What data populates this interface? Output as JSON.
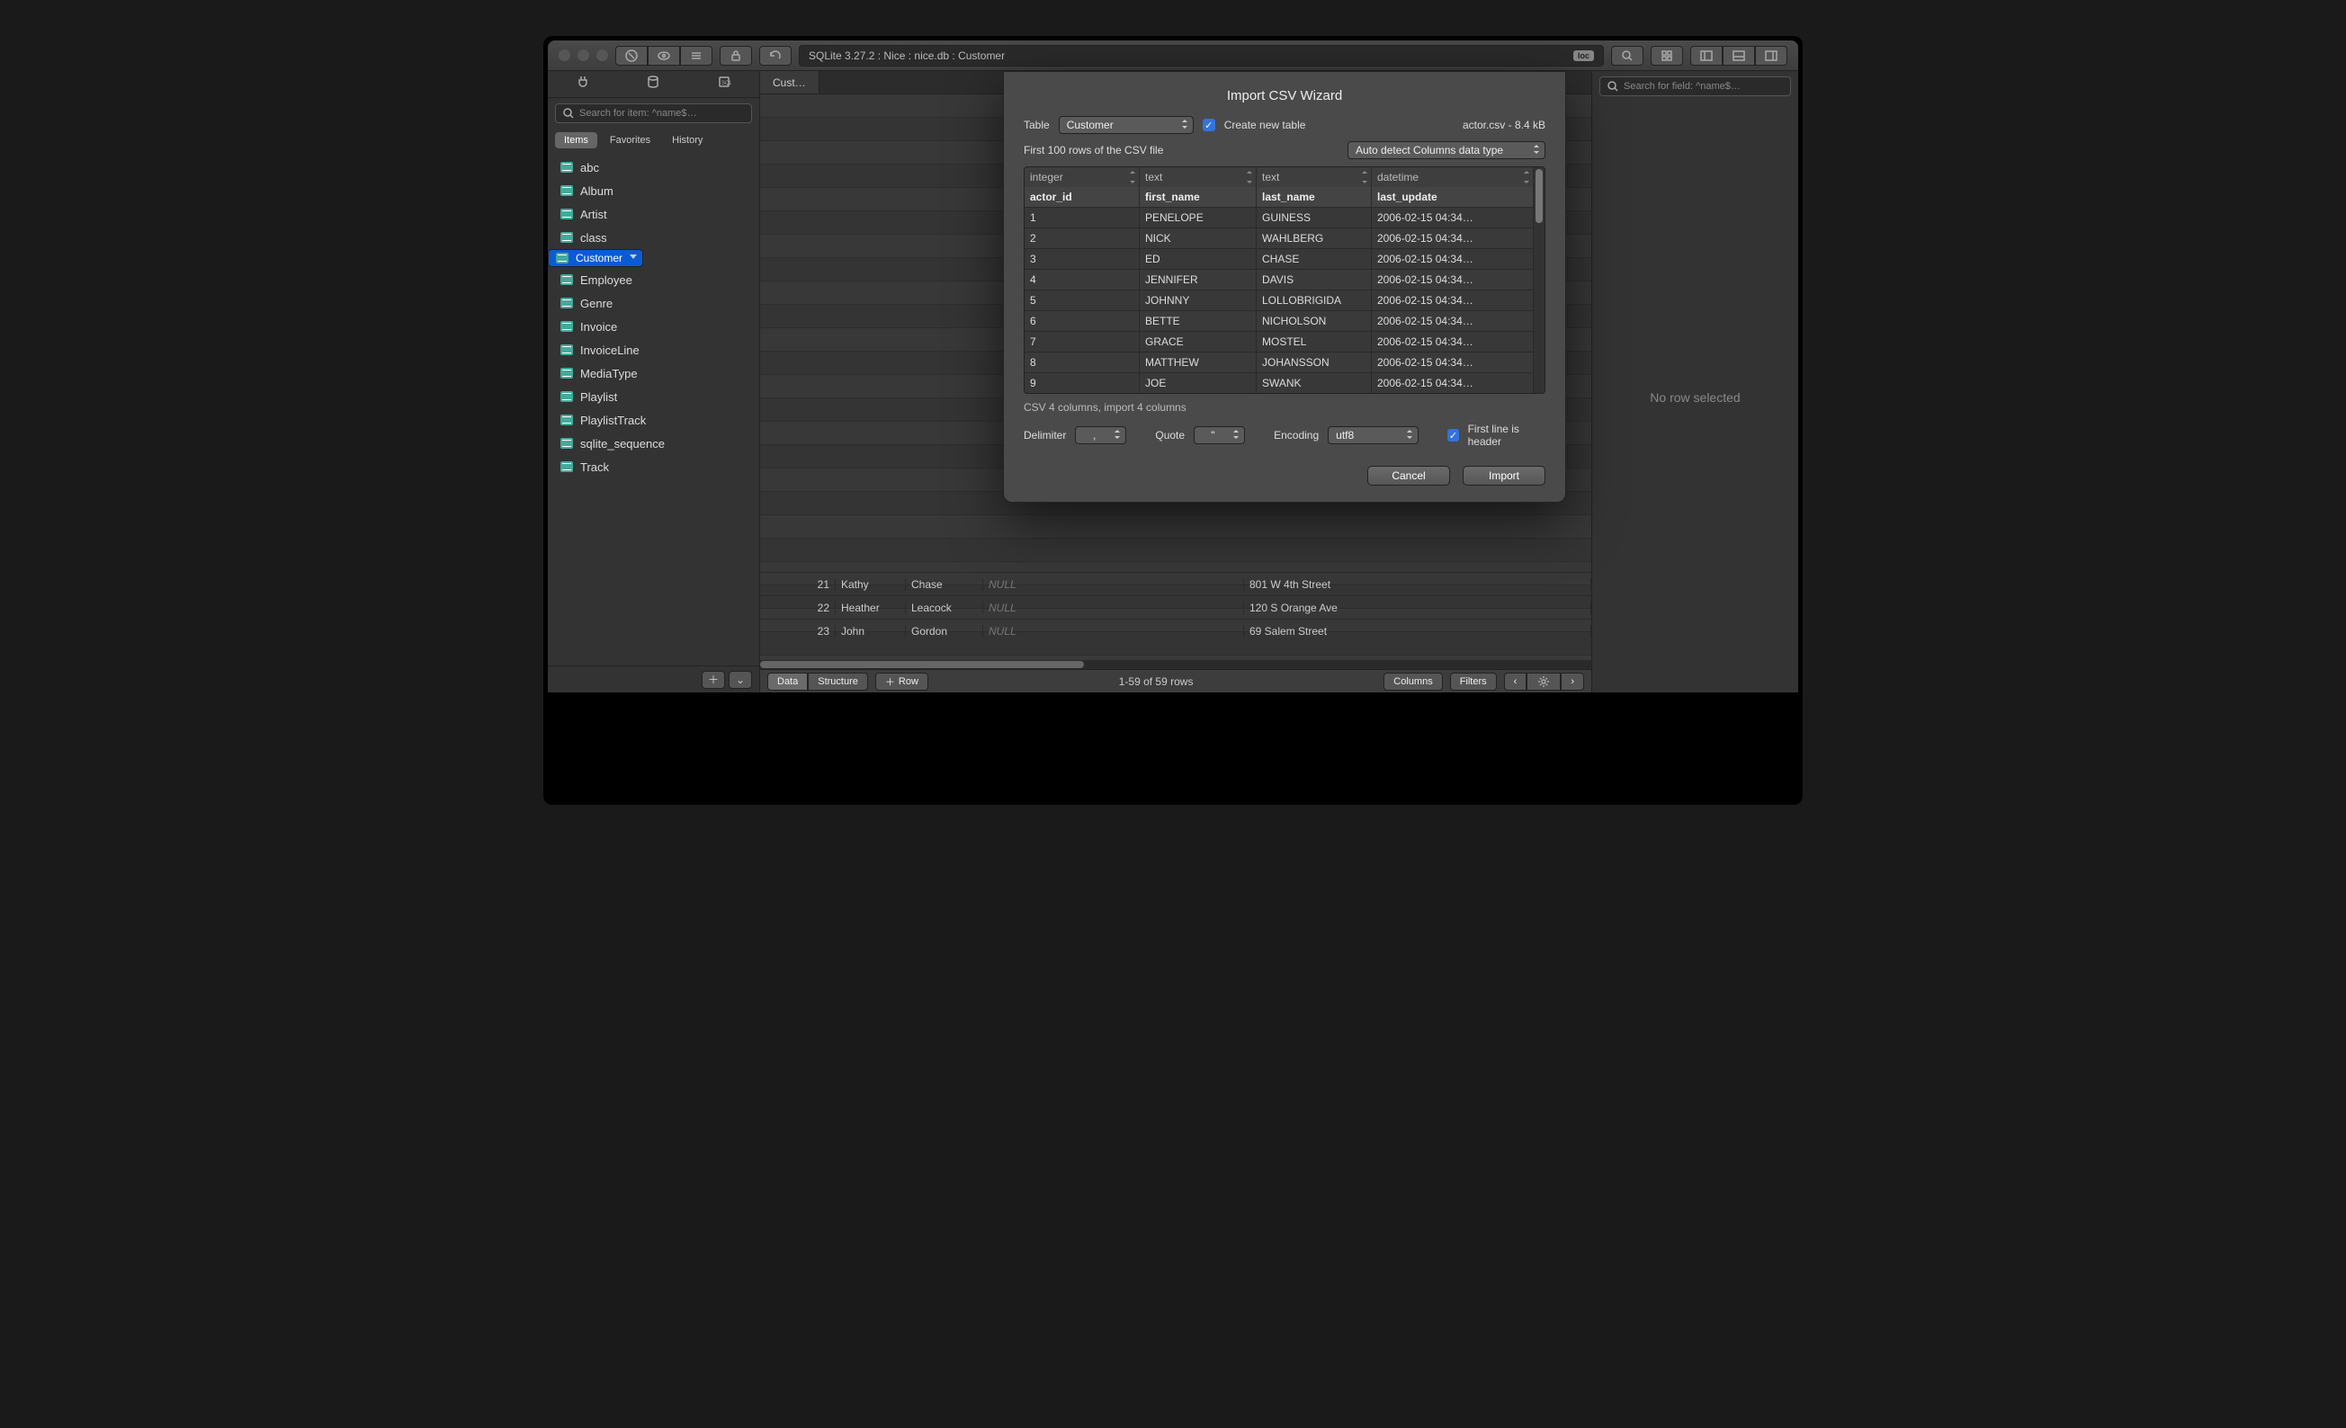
{
  "title_path": "SQLite 3.27.2 : Nice : nice.db : Customer",
  "loc_badge": "loc",
  "sidebar": {
    "search_placeholder": "Search for item: ^name$…",
    "scopes": [
      "Items",
      "Favorites",
      "History"
    ],
    "items": [
      "abc",
      "Album",
      "Artist",
      "class",
      "Customer",
      "Employee",
      "Genre",
      "Invoice",
      "InvoiceLine",
      "MediaType",
      "Playlist",
      "PlaylistTrack",
      "sqlite_sequence",
      "Track"
    ]
  },
  "tab_label": "Cust…",
  "bg_rows": [
    {
      "n": "21",
      "fn": "Kathy",
      "ln": "Chase",
      "c": "NULL",
      "addr": "801 W 4th Street"
    },
    {
      "n": "22",
      "fn": "Heather",
      "ln": "Leacock",
      "c": "NULL",
      "addr": "120 S Orange Ave"
    },
    {
      "n": "23",
      "fn": "John",
      "ln": "Gordon",
      "c": "NULL",
      "addr": "69 Salem Street"
    }
  ],
  "footer": {
    "segments": [
      "Data",
      "Structure"
    ],
    "row_btn": "Row",
    "status": "1-59 of 59 rows",
    "columns_btn": "Columns",
    "filters_btn": "Filters"
  },
  "rightpanel": {
    "search_placeholder": "Search for field: ^name$…",
    "empty": "No row selected"
  },
  "dialog": {
    "title": "Import CSV Wizard",
    "table_label": "Table",
    "table_value": "Customer",
    "create_new": "Create new table",
    "file_info": "actor.csv  -   8.4 kB",
    "first_rows_label": "First 100 rows of the CSV file",
    "autodetect": "Auto detect Columns data type",
    "col_types": [
      "integer",
      "text",
      "text",
      "datetime"
    ],
    "col_headers": [
      "actor_id",
      "first_name",
      "last_name",
      "last_update"
    ],
    "rows": [
      [
        "1",
        "PENELOPE",
        "GUINESS",
        "2006-02-15 04:34…"
      ],
      [
        "2",
        "NICK",
        "WAHLBERG",
        "2006-02-15 04:34…"
      ],
      [
        "3",
        "ED",
        "CHASE",
        "2006-02-15 04:34…"
      ],
      [
        "4",
        "JENNIFER",
        "DAVIS",
        "2006-02-15 04:34…"
      ],
      [
        "5",
        "JOHNNY",
        "LOLLOBRIGIDA",
        "2006-02-15 04:34…"
      ],
      [
        "6",
        "BETTE",
        "NICHOLSON",
        "2006-02-15 04:34…"
      ],
      [
        "7",
        "GRACE",
        "MOSTEL",
        "2006-02-15 04:34…"
      ],
      [
        "8",
        "MATTHEW",
        "JOHANSSON",
        "2006-02-15 04:34…"
      ],
      [
        "9",
        "JOE",
        "SWANK",
        "2006-02-15 04:34…"
      ]
    ],
    "summary": "CSV 4 columns, import 4 columns",
    "delimiter_label": "Delimiter",
    "delimiter_value": ",",
    "quote_label": "Quote",
    "quote_value": "\"",
    "encoding_label": "Encoding",
    "encoding_value": "utf8",
    "first_line_header": "First line is header",
    "cancel": "Cancel",
    "import": "Import"
  }
}
